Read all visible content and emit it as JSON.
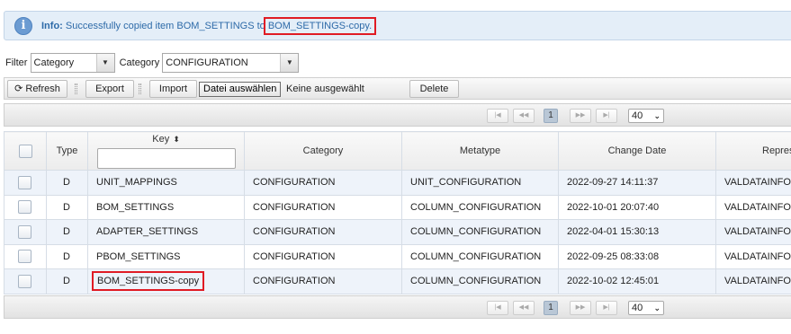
{
  "info": {
    "prefix": "Info:",
    "message": "Successfully copied item BOM_SETTINGS to",
    "target": "BOM_SETTINGS-copy."
  },
  "filter": {
    "filter_label": "Filter",
    "filter_value": "Category",
    "category_label": "Category",
    "category_value": "CONFIGURATION"
  },
  "toolbar": {
    "refresh": "Refresh",
    "export": "Export",
    "import": "Import",
    "file_choose": "Datei auswählen",
    "file_status": "Keine ausgewählt",
    "delete": "Delete"
  },
  "pager": {
    "page": "1",
    "page_size": "40"
  },
  "table": {
    "columns": {
      "type": "Type",
      "key": "Key",
      "category": "Category",
      "metatype": "Metatype",
      "change_date": "Change Date",
      "repres": "Repres"
    },
    "rows": [
      {
        "type": "D",
        "key": "UNIT_MAPPINGS",
        "category": "CONFIGURATION",
        "metatype": "UNIT_CONFIGURATION",
        "change_date": "2022-09-27 14:11:37",
        "repres": "VALDATAINFO"
      },
      {
        "type": "D",
        "key": "BOM_SETTINGS",
        "category": "CONFIGURATION",
        "metatype": "COLUMN_CONFIGURATION",
        "change_date": "2022-10-01 20:07:40",
        "repres": "VALDATAINFO"
      },
      {
        "type": "D",
        "key": "ADAPTER_SETTINGS",
        "category": "CONFIGURATION",
        "metatype": "COLUMN_CONFIGURATION",
        "change_date": "2022-04-01 15:30:13",
        "repres": "VALDATAINFO"
      },
      {
        "type": "D",
        "key": "PBOM_SETTINGS",
        "category": "CONFIGURATION",
        "metatype": "COLUMN_CONFIGURATION",
        "change_date": "2022-09-25 08:33:08",
        "repres": "VALDATAINFO"
      },
      {
        "type": "D",
        "key": "BOM_SETTINGS-copy",
        "category": "CONFIGURATION",
        "metatype": "COLUMN_CONFIGURATION",
        "change_date": "2022-10-02 12:45:01",
        "repres": "VALDATAINFO"
      }
    ]
  },
  "colors": {
    "info_text": "#2d6aa8",
    "highlight": "#e01b24"
  }
}
